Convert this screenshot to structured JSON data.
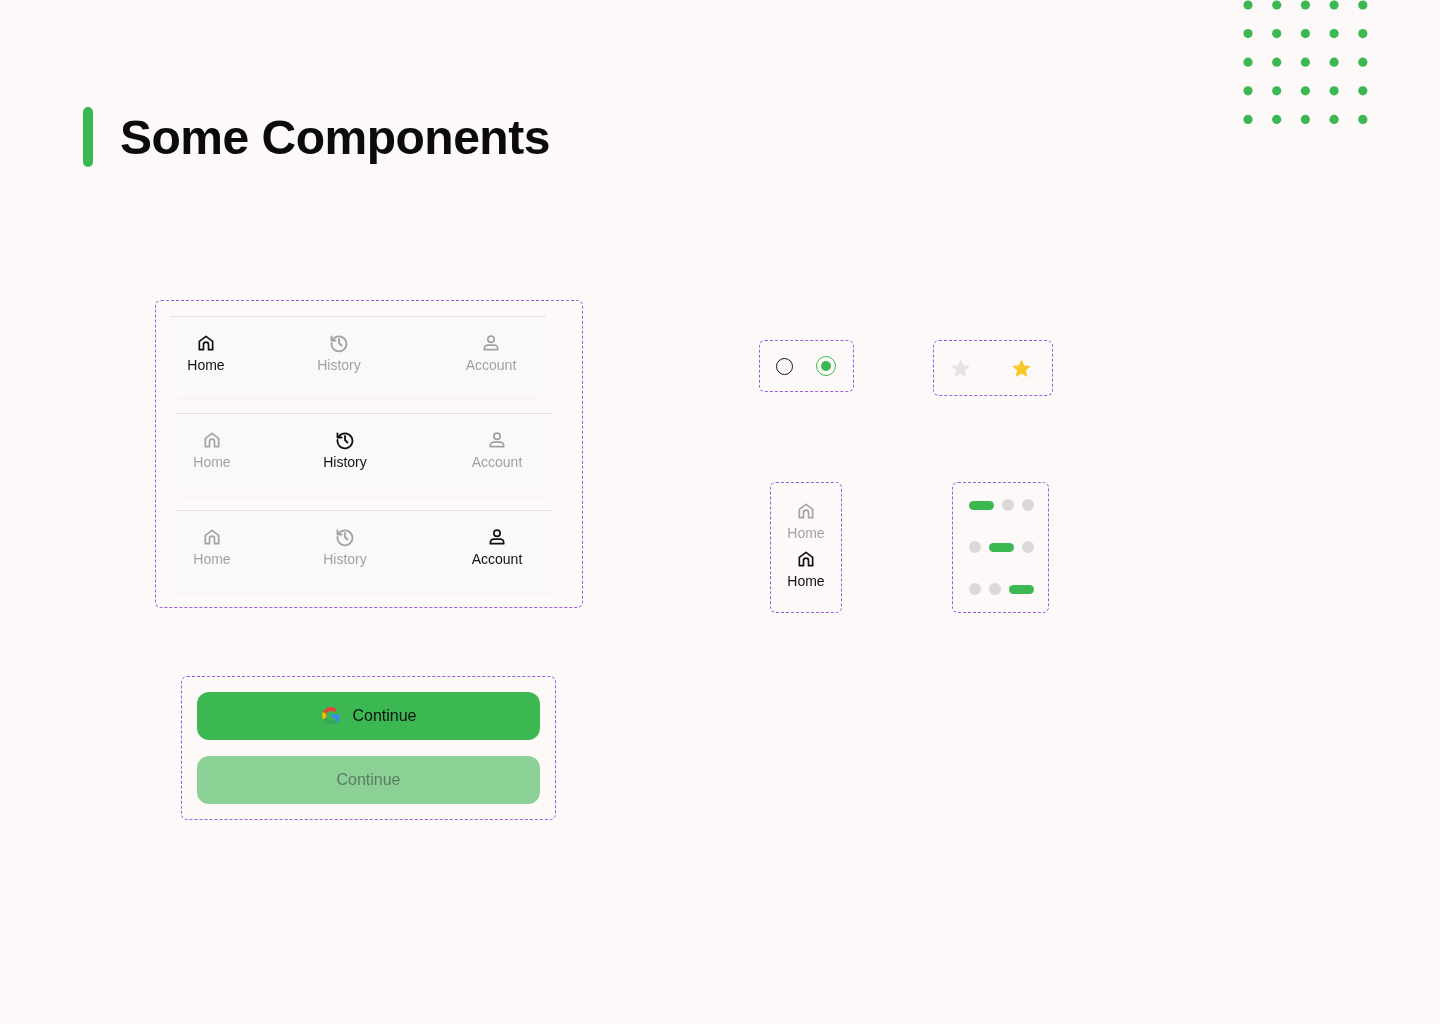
{
  "title": "Some Components",
  "nav_bars": [
    {
      "items": [
        {
          "label": "Home",
          "kind": "home",
          "selected": true
        },
        {
          "label": "History",
          "kind": "history",
          "selected": false
        },
        {
          "label": "Account",
          "kind": "account",
          "selected": false
        }
      ]
    },
    {
      "items": [
        {
          "label": "Home",
          "kind": "home",
          "selected": false
        },
        {
          "label": "History",
          "kind": "history",
          "selected": true
        },
        {
          "label": "Account",
          "kind": "account",
          "selected": false
        }
      ]
    },
    {
      "items": [
        {
          "label": "Home",
          "kind": "home",
          "selected": false
        },
        {
          "label": "History",
          "kind": "history",
          "selected": false
        },
        {
          "label": "Account",
          "kind": "account",
          "selected": true
        }
      ]
    }
  ],
  "radios": [
    {
      "selected": false
    },
    {
      "selected": true
    }
  ],
  "star_toggles": [
    {
      "checked": false
    },
    {
      "checked": true
    }
  ],
  "vertical_nav_items": [
    {
      "label": "Home",
      "kind": "home",
      "selected": false
    },
    {
      "label": "Home",
      "kind": "home",
      "selected": true
    }
  ],
  "page_indicators": [
    {
      "dots": [
        {
          "selected": true
        },
        {
          "selected": false
        },
        {
          "selected": false
        }
      ]
    },
    {
      "dots": [
        {
          "selected": false
        },
        {
          "selected": true
        },
        {
          "selected": false
        }
      ]
    },
    {
      "dots": [
        {
          "selected": false
        },
        {
          "selected": false
        },
        {
          "selected": true
        }
      ]
    }
  ],
  "buttons": [
    {
      "label": "Continue",
      "kind": "google",
      "disabled": false
    },
    {
      "label": "Continue",
      "kind": "plain",
      "disabled": true
    }
  ]
}
